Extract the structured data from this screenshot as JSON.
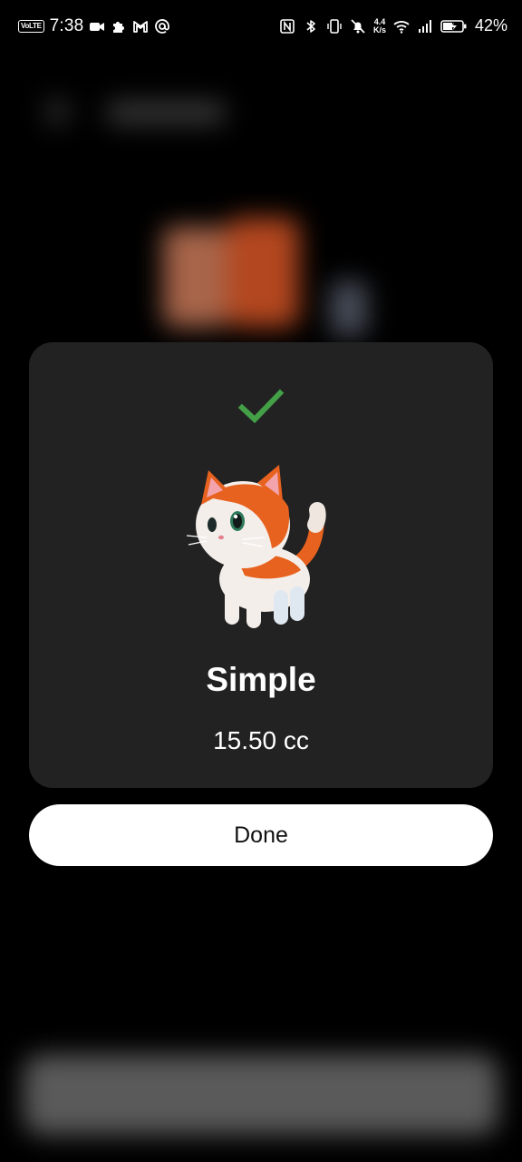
{
  "status_bar": {
    "time": "7:38",
    "volte_label": "VoLTE",
    "net_speed_value": "4.4",
    "net_speed_unit": "K/s",
    "battery_percent": "42%",
    "left_icons": [
      "video-camera-icon",
      "puzzle-icon",
      "gmail-icon",
      "at-sign-icon"
    ],
    "right_icons": [
      "nfc-icon",
      "bluetooth-icon",
      "vibrate-icon",
      "mute-bell-icon",
      "wifi-icon",
      "signal-icon",
      "battery-charging-icon"
    ]
  },
  "dialog": {
    "title": "Simple",
    "amount": "15.50 cc",
    "success_icon": "checkmark-icon",
    "success_color": "#43a047",
    "illustration": "cat-illustration"
  },
  "actions": {
    "done_label": "Done"
  },
  "colors": {
    "card_background": "#222223",
    "button_background": "#ffffff",
    "screen_background": "#000000"
  }
}
